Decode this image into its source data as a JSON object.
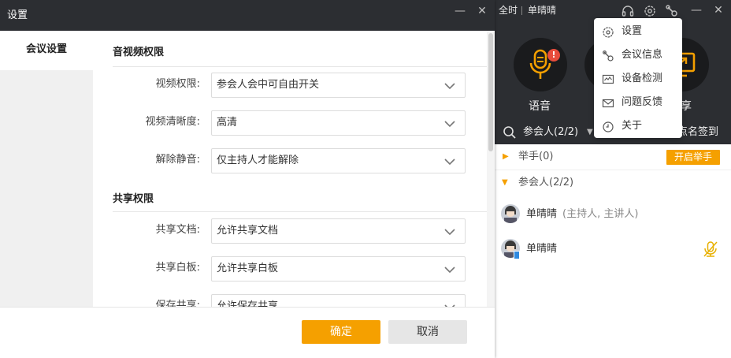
{
  "meeting": {
    "title_left": "全时",
    "title_user": "单晴晴",
    "tools": {
      "voice_label": "语音",
      "share_label_partial": "享"
    },
    "search": {
      "participants_label": "参会人(2/2)",
      "rollcall_label": "点名签到"
    },
    "raise_group": {
      "label": "举手(0)",
      "button": "开启举手"
    },
    "participants_group": {
      "label": "参会人(2/2)"
    },
    "members": [
      {
        "name": "单晴晴",
        "role": "(主持人, 主讲人)"
      },
      {
        "name": "单晴晴",
        "role": ""
      }
    ],
    "colors": {
      "accent": "#f5a000",
      "dark": "#2c2e32",
      "alert": "#e74c3c"
    }
  },
  "menu": {
    "items": [
      {
        "label": "设置",
        "icon": "gear-icon"
      },
      {
        "label": "会议信息",
        "icon": "link-icon"
      },
      {
        "label": "设备检测",
        "icon": "monitor-icon"
      },
      {
        "label": "问题反馈",
        "icon": "mail-icon"
      },
      {
        "label": "关于",
        "icon": "clock-icon"
      }
    ]
  },
  "dialog": {
    "title": "设置",
    "sidebar_items": [
      "会议设置"
    ],
    "sections": [
      {
        "title": "音视频权限",
        "fields": [
          {
            "label": "视频权限:",
            "value": "参会人会中可自由开关"
          },
          {
            "label": "视频清晰度:",
            "value": "高清"
          },
          {
            "label": "解除静音:",
            "value": "仅主持人才能解除"
          }
        ]
      },
      {
        "title": "共享权限",
        "fields": [
          {
            "label": "共享文档:",
            "value": "允许共享文档"
          },
          {
            "label": "共享白板:",
            "value": "允许共享白板"
          },
          {
            "label": "保存共享:",
            "value": "允许保存共享"
          }
        ]
      }
    ],
    "ok_label": "确定",
    "cancel_label": "取消"
  }
}
